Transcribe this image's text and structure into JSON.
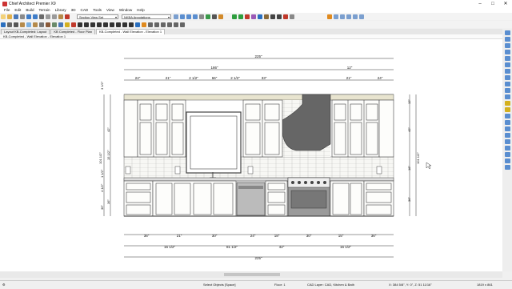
{
  "window": {
    "title": "Chief Architect Premier X9"
  },
  "menu": [
    "File",
    "Edit",
    "Build",
    "Terrain",
    "Library",
    "3D",
    "CAD",
    "Tools",
    "View",
    "Window",
    "Help"
  ],
  "toolbar": {
    "layer_set": "Section View Set",
    "annotation_set": "NKBA Annotations"
  },
  "tabs": [
    "Layout KB-Completed: Layout",
    "KB Completed - Floor Plan",
    "KB-Completed - Wall Elevation - Elevation 1"
  ],
  "breadcrumb": "KB-Completed - Wall Elevation - Elevation 1",
  "dims": {
    "overall": "225\"",
    "sec_186": "186\"",
    "sec_12": "12\"",
    "top_24a": "24\"",
    "top_21a": "21\"",
    "top_2_1a": "2 1/2\"",
    "top_66": "66\"",
    "top_2_1b": "2 1/2\"",
    "top_33": "33\"",
    "top_21b": "21\"",
    "top_24b": "24\"",
    "bot_36": "36\"",
    "bot_21": "21\"",
    "bot_30": "30\"",
    "bot_24": "24\"",
    "bot_18": "18\"",
    "bot_30b": "30\"",
    "bot_15": "15\"",
    "bot_36b": "36\"",
    "b2_16a": "16 1/2\"",
    "b2_81": "81 1/2\"",
    "b2_42": "42\"",
    "b2_16b": "16 1/2\"",
    "bottom_total": "225\"",
    "lv_1": "3 1/2\"",
    "lv_2": "42\"",
    "lv_3": "15 1/2\"",
    "lv_4": "1 1/2\"",
    "lv_5": "36\"",
    "lv_total": "101 1/2\"",
    "lv_6": "4 1/2\"",
    "lv_7": "36\"",
    "rv_1": "12\"",
    "rv_2": "42\"",
    "rv_3": "18\"",
    "rv_4": "36\"",
    "rv_total": "101 1/2\""
  },
  "status": {
    "mode": "Select Objects [Space]",
    "floor": "Floor: 1",
    "layer": "CAD Layer: CAD, Kitchen & Bath",
    "coords": "X: 384 5/8\", Y: 0\", Z: 51 11/16\"",
    "size": "1819 x 861"
  },
  "colors": {
    "accent_green": "#2e9e3e",
    "accent_blue": "#2a6fbf",
    "accent_red": "#c0392b",
    "accent_orange": "#e08a1e"
  }
}
